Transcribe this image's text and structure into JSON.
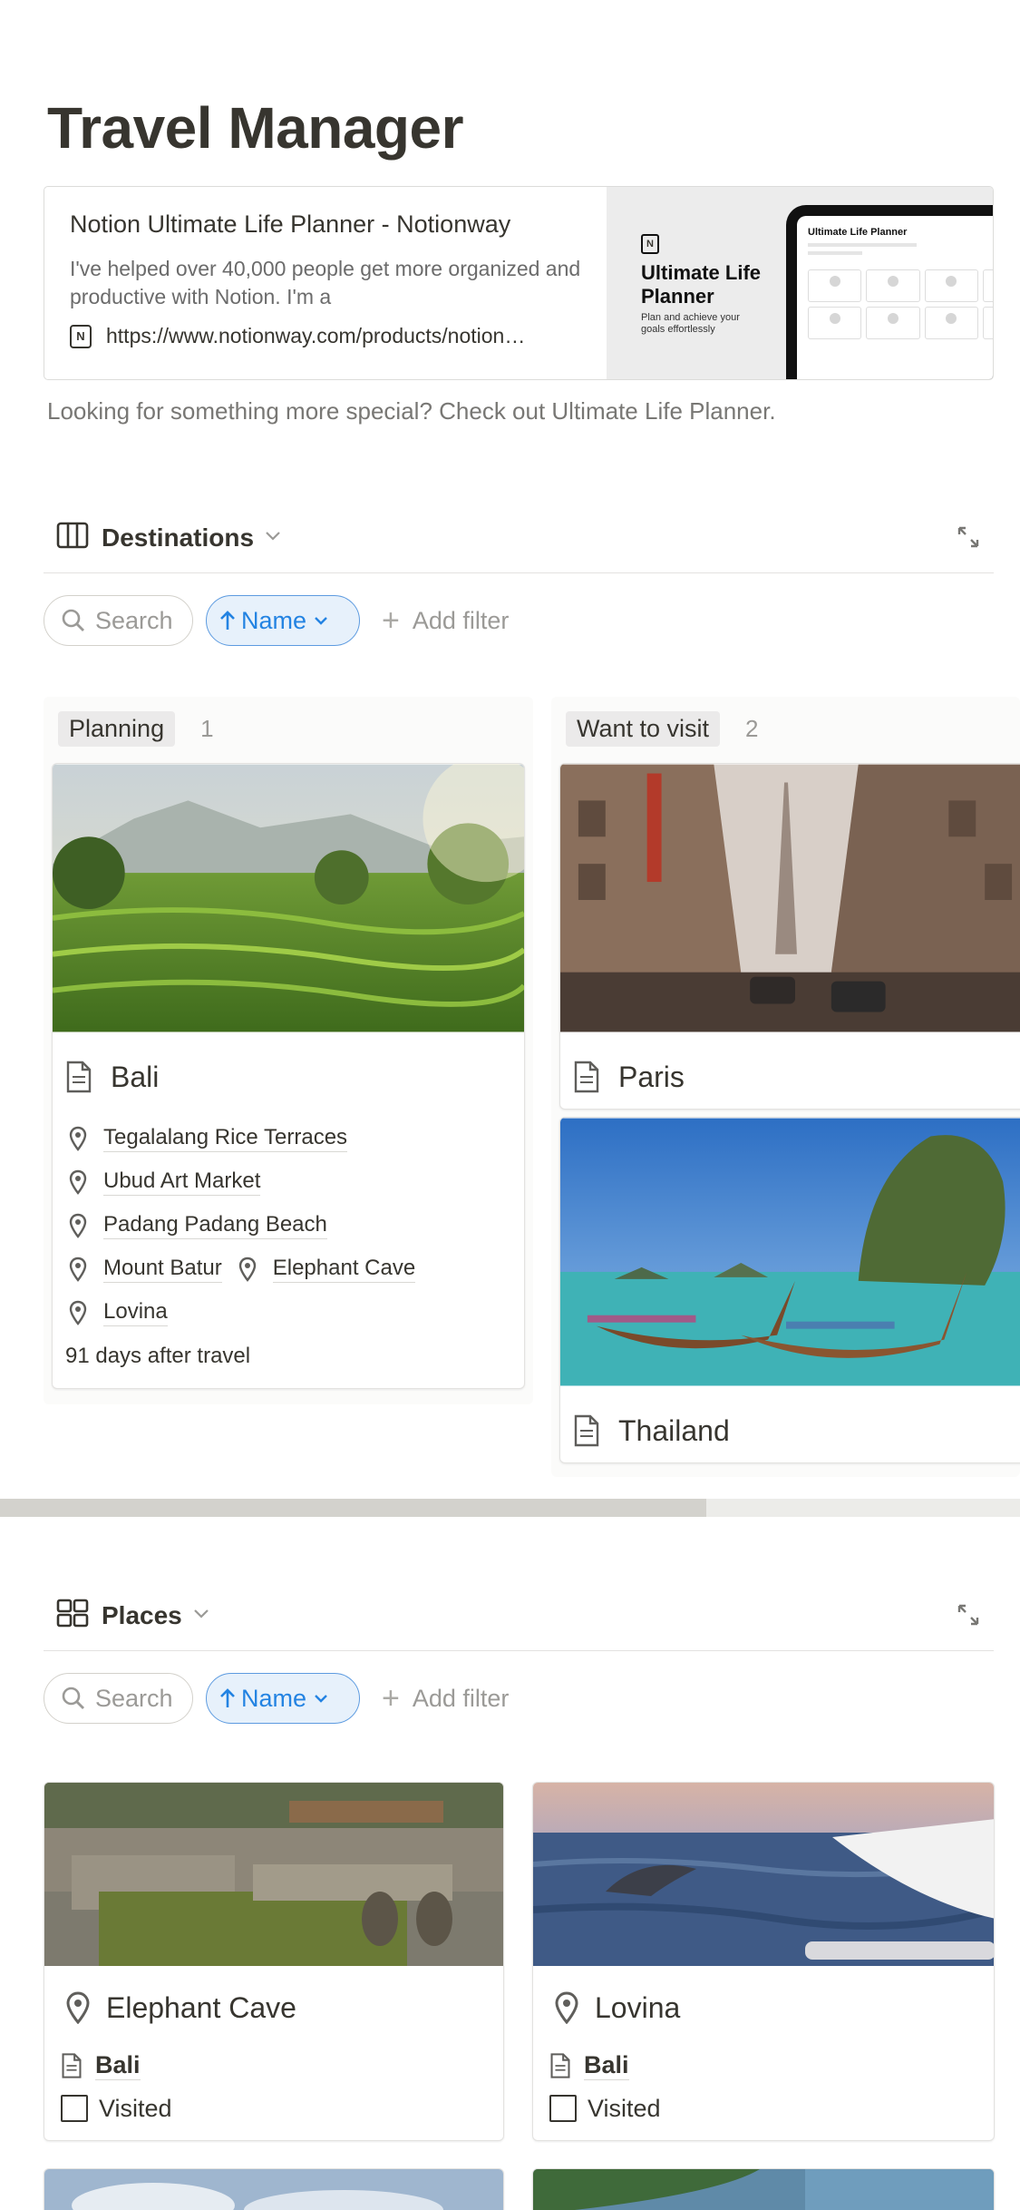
{
  "page": {
    "title": "Travel Manager"
  },
  "bookmark": {
    "title": "Notion Ultimate Life Planner - Notionway",
    "description": "I've helped over 40,000 people get more organized and productive with Notion. I'm a",
    "url": "https://www.notionway.com/products/notion…",
    "thumbnail_title": "Ultimate Life Planner",
    "thumbnail_subtitle": "Plan and achieve your goals effortlessly",
    "thumbnail_screen_title": "Ultimate Life Planner"
  },
  "caption": "Looking for something more special? Check out Ultimate Life Planner.",
  "destinations_view": {
    "name": "Destinations",
    "search_label": "Search",
    "sort_label": "Name",
    "add_filter_label": "Add filter",
    "columns": [
      {
        "status": "Planning",
        "count": "1",
        "cards": [
          {
            "title": "Bali",
            "places": [
              "Tegalalang Rice Terraces",
              "Ubud Art Market",
              "Padang Padang Beach",
              "Mount Batur",
              "Elephant Cave",
              "Lovina"
            ],
            "formula": "91 days after travel"
          }
        ]
      },
      {
        "status": "Want to visit",
        "count": "2",
        "cards": [
          {
            "title": "Paris"
          },
          {
            "title": "Thailand"
          }
        ]
      }
    ]
  },
  "places_view": {
    "name": "Places",
    "search_label": "Search",
    "sort_label": "Name",
    "add_filter_label": "Add filter",
    "cards": [
      {
        "title": "Elephant Cave",
        "destination": "Bali",
        "checkbox_label": "Visited",
        "visited": false
      },
      {
        "title": "Lovina",
        "destination": "Bali",
        "checkbox_label": "Visited",
        "visited": false
      }
    ]
  },
  "colors": {
    "text": "#37352f",
    "muted": "#787774",
    "accent_blue": "#2383e2",
    "border": "#e3e2e0"
  },
  "icons": {
    "board_view": "board-view-icon",
    "gallery_view": "gallery-view-icon",
    "expand": "expand-icon",
    "search": "search-icon",
    "sort": "arrow-up-icon",
    "page": "page-icon",
    "place": "map-pin-icon"
  }
}
